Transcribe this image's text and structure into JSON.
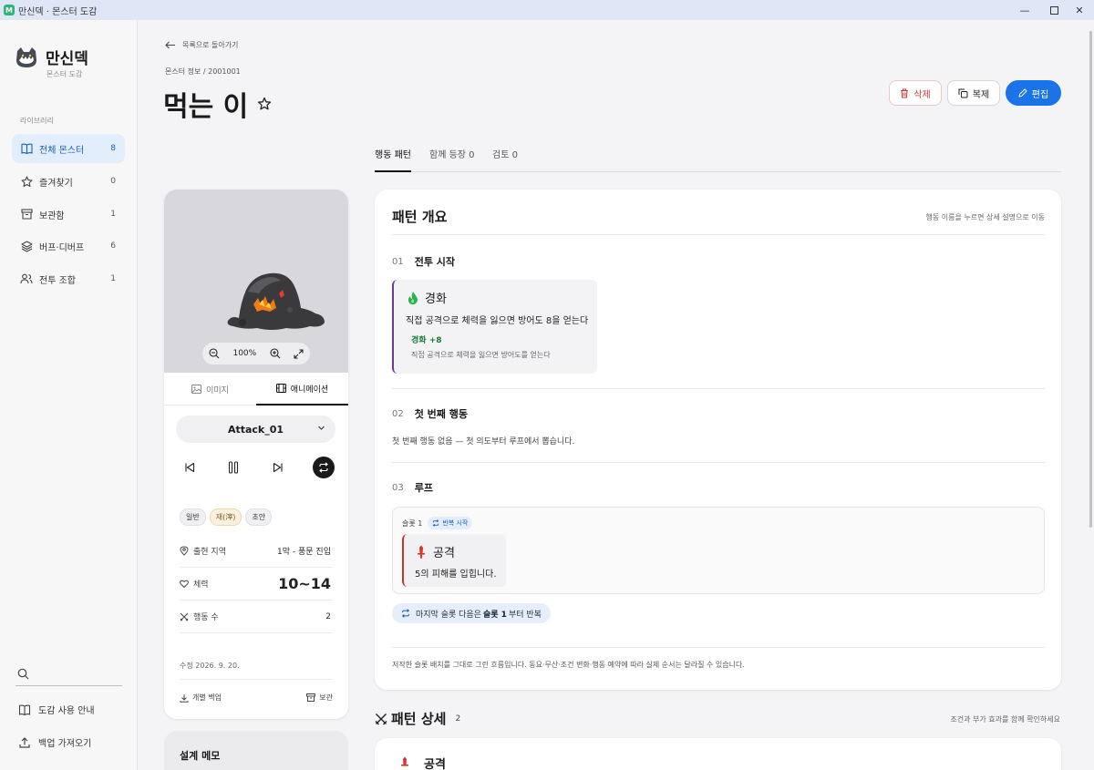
{
  "window": {
    "title": "만신덱 · 몬스터 도감",
    "app_icon": "M",
    "controls": [
      "minimize-icon",
      "maximize-icon",
      "close-icon"
    ]
  },
  "sidebar": {
    "brand_name": "만신덱",
    "brand_sub": "몬스터 도감",
    "section_label": "라이브러리",
    "items": [
      {
        "label": "전체 몬스터",
        "count": "8",
        "icon": "book-icon",
        "active": true
      },
      {
        "label": "즐겨찾기",
        "count": "0",
        "icon": "star-icon"
      },
      {
        "label": "보관함",
        "count": "1",
        "icon": "archive-icon"
      },
      {
        "label": "버프·디버프",
        "count": "6",
        "icon": "layers-icon"
      },
      {
        "label": "전투 조합",
        "count": "1",
        "icon": "users-icon"
      }
    ],
    "search_icon": "search-icon",
    "bottom": [
      {
        "label": "도감 사용 안내",
        "icon": "guide-icon"
      },
      {
        "label": "백업 가져오기",
        "icon": "upload-icon"
      }
    ]
  },
  "header": {
    "back_label": "목록으로 돌아가기",
    "breadcrumb": "몬스터 정보 / 2001001",
    "title": "먹는 이",
    "delete_label": "삭제",
    "duplicate_label": "복제",
    "edit_label": "편집"
  },
  "tabs": [
    {
      "label": "행동 패턴",
      "active": true
    },
    {
      "label": "함께 등장 0"
    },
    {
      "label": "검토 0"
    }
  ],
  "monster_card": {
    "zoom": "100%",
    "media_tabs": [
      {
        "label": "이미지"
      },
      {
        "label": "애니메이션",
        "active": true
      }
    ],
    "animation": "Attack_01",
    "tags": [
      "일반",
      "재(滓)",
      "초안"
    ],
    "location_label": "출현 지역",
    "location_value": "1막 - 풍문 진입",
    "hp_label": "체력",
    "hp_value": "10~14",
    "actions_label": "행동 수",
    "actions_value": "2",
    "modified": "수정 2026. 9. 20.",
    "backup_label": "개별 백업",
    "archive_label": "보관"
  },
  "memo": {
    "title": "설계 메모"
  },
  "pattern_overview": {
    "title": "패턴 개요",
    "hint": "행동 이름을 누르면 상세 설명으로 이동",
    "steps": [
      {
        "num": "01",
        "name": "전투 시작"
      },
      {
        "num": "02",
        "name": "첫 번째 행동"
      },
      {
        "num": "03",
        "name": "루프"
      }
    ],
    "buff": {
      "name": "경화",
      "desc": "직접 공격으로 체력을 잃으면 방어도 8을 얻는다",
      "effect_title": "경화 +8",
      "effect_desc": "직접 공격으로 체력을 잃으면 방어도를 얻는다"
    },
    "first_action_note": "첫 번째 행동 없음 — 첫 의도부터 루프에서 뽑습니다.",
    "slot_label": "슬롯 1",
    "slot_chip": "반복 시작",
    "attack": {
      "name": "공격",
      "desc": "5의 피해를 입힙니다."
    },
    "repeat": {
      "pre": "마지막 슬롯 다음은",
      "bold": "슬롯 1",
      "post": "부터 반복"
    },
    "footer_note": "저작한 슬롯 배치를 그대로 그린 흐름입니다. 동요·무산·조건 변화·행동 예약에 따라 실제 순서는 달라질 수 있습니다."
  },
  "pattern_detail": {
    "title": "패턴 상세",
    "count": "2",
    "hint": "조건과 부가 효과를 함께 확인하세요",
    "first_action": "공격"
  },
  "colors": {
    "accent": "#1a73e8",
    "danger": "#c23b3b",
    "buff_green": "#1e7a3a",
    "sidebar_active": "#e3eefc"
  }
}
